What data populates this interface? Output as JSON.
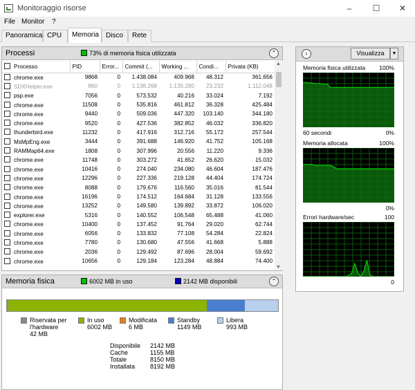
{
  "window": {
    "title": "Monitoraggio risorse"
  },
  "menu": [
    "File",
    "Monitor",
    "?"
  ],
  "tabs": [
    "Panoramica",
    "CPU",
    "Memoria",
    "Disco",
    "Rete"
  ],
  "processes": {
    "title": "Processi",
    "summary": "73% di memoria fisica utilizzata",
    "columns": [
      "Processo",
      "PID",
      "Error...",
      "Commit (...",
      "Working ...",
      "Condi...",
      "Privata (KB)"
    ],
    "rows": [
      [
        "chrome.exe",
        "9868",
        "0",
        "1.438.084",
        "409.968",
        "48.312",
        "361.656"
      ],
      [
        "SDXHelper.exe",
        "860",
        "0",
        "1.138.268",
        "1.135.280",
        "23.232",
        "1.112.048"
      ],
      [
        "psp.exe",
        "7056",
        "0",
        "573.532",
        "40.216",
        "33.024",
        "7.192"
      ],
      [
        "chrome.exe",
        "11508",
        "0",
        "535.816",
        "461.812",
        "36.328",
        "425.484"
      ],
      [
        "chrome.exe",
        "9440",
        "0",
        "509.036",
        "447.320",
        "103.140",
        "344.180"
      ],
      [
        "chrome.exe",
        "9520",
        "0",
        "427.536",
        "382.852",
        "46.032",
        "336.820"
      ],
      [
        "thunderbird.exe",
        "11232",
        "0",
        "417.916",
        "312.716",
        "55.172",
        "257.544"
      ],
      [
        "MsMpEng.exe",
        "3444",
        "0",
        "391.688",
        "146.920",
        "41.752",
        "105.168"
      ],
      [
        "RAMMap64.exe",
        "1808",
        "0",
        "307.996",
        "20.556",
        "11.220",
        "9.336"
      ],
      [
        "chrome.exe",
        "11748",
        "0",
        "303.272",
        "41.652",
        "26.620",
        "15.032"
      ],
      [
        "chrome.exe",
        "10416",
        "0",
        "274.040",
        "234.080",
        "46.604",
        "187.476"
      ],
      [
        "chrome.exe",
        "12296",
        "0",
        "227.336",
        "219.128",
        "44.404",
        "174.724"
      ],
      [
        "chrome.exe",
        "8088",
        "0",
        "179.676",
        "116.560",
        "35.016",
        "81.544"
      ],
      [
        "chrome.exe",
        "16196",
        "0",
        "174.512",
        "164.684",
        "31.128",
        "133.556"
      ],
      [
        "chrome.exe",
        "13252",
        "0",
        "149.580",
        "139.892",
        "33.872",
        "106.020"
      ],
      [
        "explorer.exe",
        "5316",
        "0",
        "140.552",
        "106.548",
        "65.488",
        "41.060"
      ],
      [
        "chrome.exe",
        "10400",
        "0",
        "137.452",
        "91.764",
        "29.020",
        "62.744"
      ],
      [
        "chrome.exe",
        "6056",
        "0",
        "133.832",
        "77.108",
        "54.284",
        "22.824"
      ],
      [
        "chrome.exe",
        "7780",
        "0",
        "130.680",
        "47.556",
        "41.668",
        "5.888"
      ],
      [
        "chrome.exe",
        "2036",
        "0",
        "129.492",
        "87.696",
        "28.004",
        "59.692"
      ],
      [
        "chrome.exe",
        "10656",
        "0",
        "129.184",
        "123.284",
        "48.884",
        "74.400"
      ]
    ]
  },
  "physical": {
    "title": "Memoria fisica",
    "in_use": "6002 MB in uso",
    "available": "2142 MB disponibili",
    "bar_fractions": {
      "hardware": 0.005,
      "in_use": 0.736,
      "modified": 0.001,
      "standby": 0.141,
      "free": 0.122
    },
    "legend": [
      {
        "label": "Riservata per l'hardware",
        "value": "42 MB",
        "color": "#8a8a8a"
      },
      {
        "label": "In uso",
        "value": "6002 MB",
        "color": "#8cb400"
      },
      {
        "label": "Modificata",
        "value": "6 MB",
        "color": "#ea7d17"
      },
      {
        "label": "Standby",
        "value": "1149 MB",
        "color": "#4a7fd0"
      },
      {
        "label": "Libera",
        "value": "993 MB",
        "color": "#b8d0ee"
      }
    ],
    "stats": [
      [
        "Disponibile",
        "2142 MB"
      ],
      [
        "Cache",
        "1155 MB"
      ],
      [
        "Totale",
        "8150 MB"
      ],
      [
        "Installata",
        "8192 MB"
      ]
    ]
  },
  "side": {
    "view_label": "Visualizza",
    "graphs": [
      {
        "title": "Memoria fisica utilizzata",
        "max": "100%",
        "left": "60 secondi",
        "min": "0%",
        "series": [
          82,
          82,
          81,
          81,
          80,
          80,
          80,
          79,
          79,
          73,
          73,
          73,
          73,
          73,
          73,
          73,
          73,
          73,
          73,
          73,
          73,
          73,
          73,
          73,
          73,
          73,
          73,
          73,
          73,
          73,
          73
        ]
      },
      {
        "title": "Memoria allocata",
        "max": "100%",
        "left": "",
        "min": "0%",
        "series": [
          70,
          70,
          70,
          70,
          68,
          68,
          68,
          68,
          68,
          68,
          66,
          62,
          62,
          62,
          62,
          62,
          62,
          62,
          62,
          62,
          62,
          62,
          62,
          62,
          62,
          62,
          62,
          62,
          62,
          62,
          62
        ]
      },
      {
        "title": "Errori hardware/sec",
        "max": "100",
        "left": "",
        "min": "0",
        "series": [
          0,
          0,
          0,
          0,
          0,
          0,
          0,
          0,
          0,
          0,
          0,
          0,
          0,
          0,
          0,
          2,
          6,
          24,
          8,
          0,
          10,
          30,
          4,
          0,
          0,
          0,
          0,
          0,
          0,
          0,
          0
        ]
      }
    ]
  },
  "colors": {
    "graph_line": "#00d000",
    "graph_fill": "#0d6a0d",
    "grid": "#0a5a0a",
    "summary_swatch": "#00c000",
    "avail_swatch": "#0000c0"
  }
}
